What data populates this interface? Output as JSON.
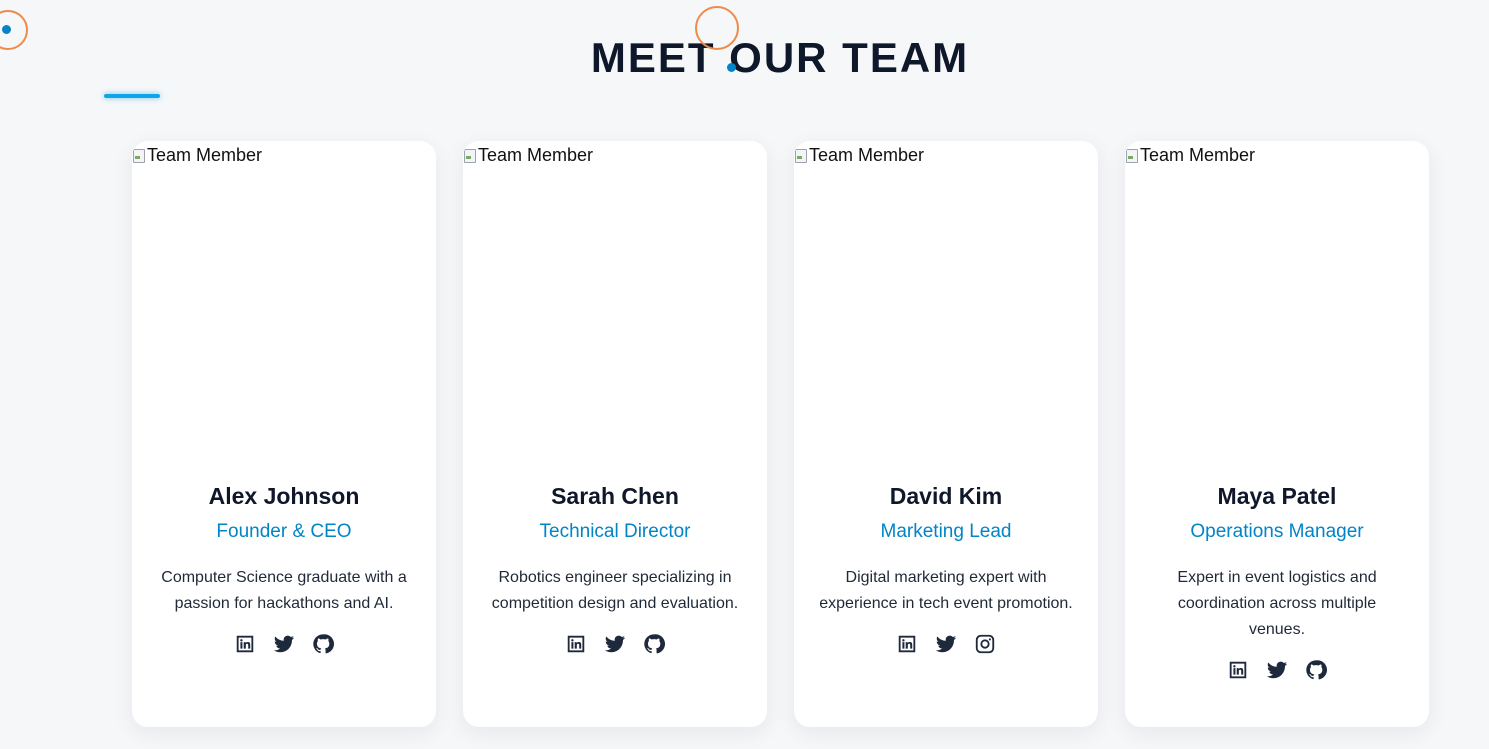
{
  "section": {
    "title": "MEET OUR TEAM"
  },
  "colors": {
    "accent": "#0284c7",
    "cursor_ring": "#f08a4b",
    "heading": "#0f172a",
    "background": "#f6f7f9"
  },
  "members": [
    {
      "image_alt": "Team Member",
      "name": "Alex Johnson",
      "role": "Founder & CEO",
      "bio": "Computer Science graduate with a passion for hackathons and AI.",
      "socials": [
        "linkedin-icon",
        "twitter-icon",
        "github-icon"
      ]
    },
    {
      "image_alt": "Team Member",
      "name": "Sarah Chen",
      "role": "Technical Director",
      "bio": "Robotics engineer specializing in competition design and evaluation.",
      "socials": [
        "linkedin-icon",
        "twitter-icon",
        "github-icon"
      ]
    },
    {
      "image_alt": "Team Member",
      "name": "David Kim",
      "role": "Marketing Lead",
      "bio": "Digital marketing expert with experience in tech event promotion.",
      "socials": [
        "linkedin-icon",
        "twitter-icon",
        "instagram-icon"
      ]
    },
    {
      "image_alt": "Team Member",
      "name": "Maya Patel",
      "role": "Operations Manager",
      "bio": "Expert in event logistics and coordination across multiple venues.",
      "socials": [
        "linkedin-icon",
        "twitter-icon",
        "github-icon"
      ]
    }
  ]
}
